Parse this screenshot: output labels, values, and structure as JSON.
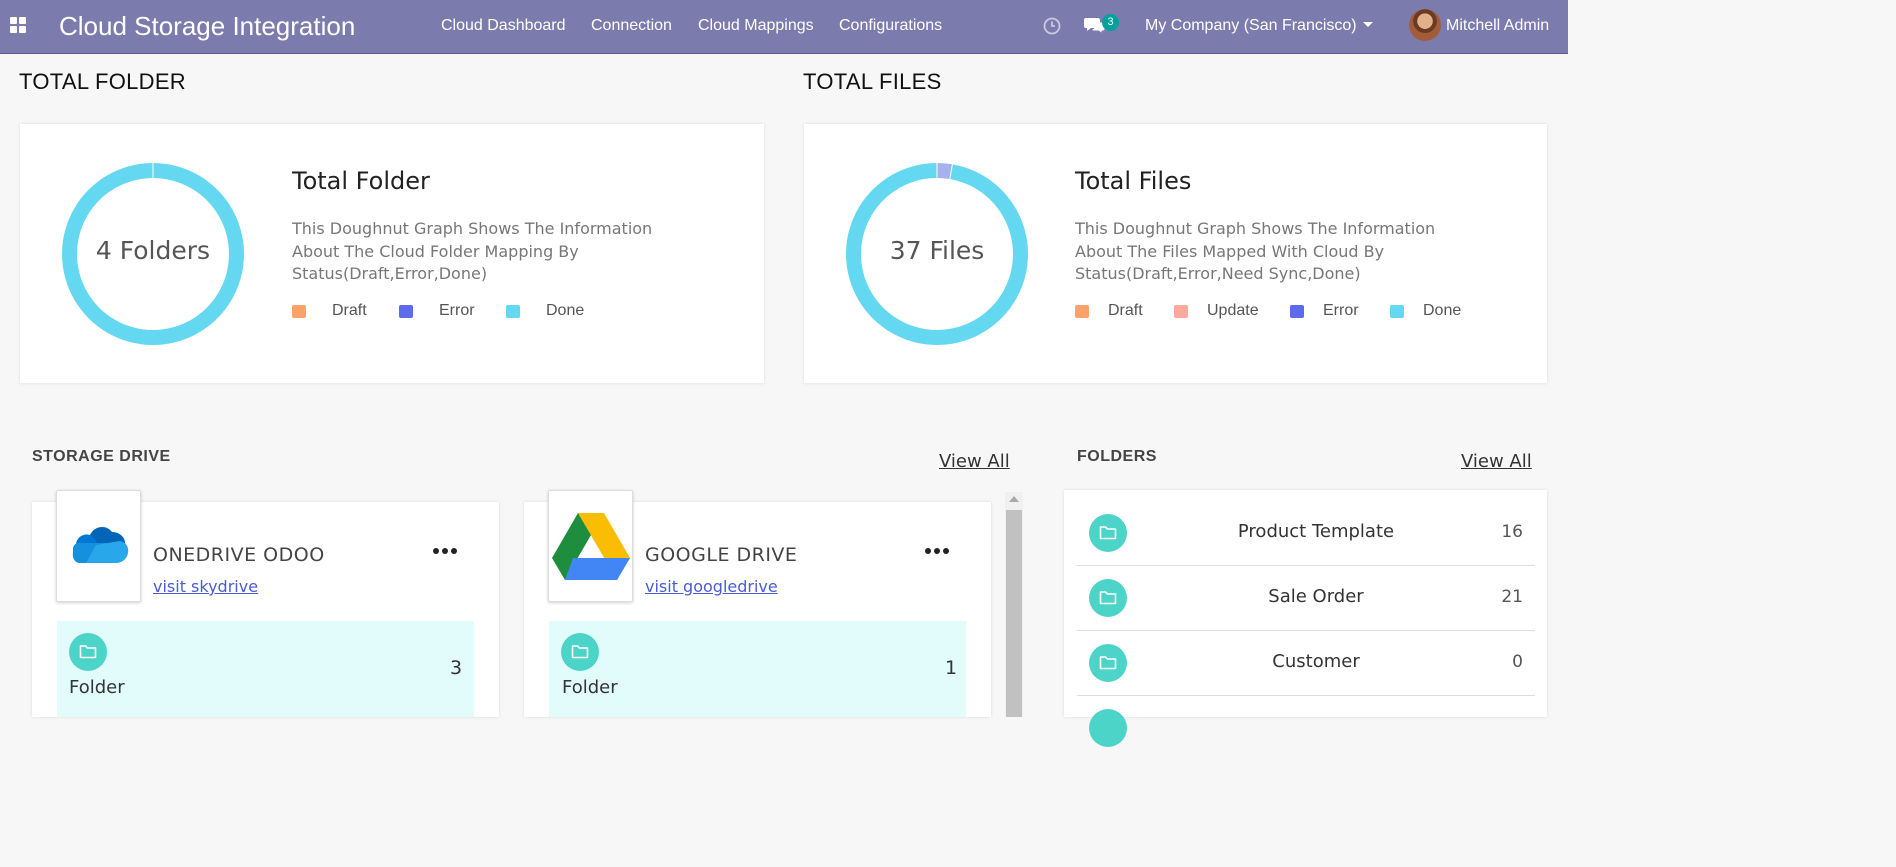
{
  "navbar": {
    "brand": "Cloud Storage Integration",
    "menu": [
      "Cloud Dashboard",
      "Connection",
      "Cloud Mappings",
      "Configurations"
    ],
    "messages_count": "3",
    "company": "My Company (San Francisco)",
    "user": "Mitchell Admin"
  },
  "total_folder": {
    "section_title": "TOTAL FOLDER",
    "center_label": "4 Folders",
    "heading": "Total Folder",
    "description": "This Doughnut Graph Shows The Information About The Cloud Folder Mapping By Status(Draft,Error,Done)",
    "legend": [
      {
        "label": "Draft",
        "color": "#fda26b"
      },
      {
        "label": "Error",
        "color": "#5b6bec"
      },
      {
        "label": "Done",
        "color": "#65d8f1"
      }
    ]
  },
  "total_files": {
    "section_title": "TOTAL FILES",
    "center_label": "37 Files",
    "heading": "Total Files",
    "description": "This Doughnut Graph Shows The Information About The Files Mapped With Cloud By Status(Draft,Error,Need Sync,Done)",
    "legend": [
      {
        "label": "Draft",
        "color": "#fda26b"
      },
      {
        "label": "Update",
        "color": "#fda99b"
      },
      {
        "label": "Error",
        "color": "#5b6bec"
      },
      {
        "label": "Done",
        "color": "#65d8f1"
      }
    ]
  },
  "chart_data": [
    {
      "type": "pie",
      "variant": "doughnut",
      "categories": [
        "Draft",
        "Error",
        "Done"
      ],
      "values": [
        0,
        0,
        4
      ],
      "colors": [
        "#fda26b",
        "#5b6bec",
        "#65d8f1"
      ]
    },
    {
      "type": "pie",
      "variant": "doughnut",
      "categories": [
        "Draft",
        "Update",
        "Error",
        "Done"
      ],
      "values": [
        0,
        1,
        0,
        36
      ],
      "colors": [
        "#fda26b",
        "#a8b1f0",
        "#5b6bec",
        "#65d8f1"
      ]
    }
  ],
  "storage_drive": {
    "title": "STORAGE DRIVE",
    "view_all": "View All",
    "drives": [
      {
        "name": "ONEDRIVE ODOO",
        "link": "visit skydrive",
        "folder_label": "Folder",
        "folder_count": "3",
        "icon": "onedrive-icon"
      },
      {
        "name": "GOOGLE DRIVE",
        "link": "visit googledrive",
        "folder_label": "Folder",
        "folder_count": "1",
        "icon": "google-drive-icon"
      }
    ]
  },
  "folders": {
    "title": "FOLDERS",
    "view_all": "View All",
    "items": [
      {
        "name": "Product Template",
        "count": "16"
      },
      {
        "name": "Sale Order",
        "count": "21"
      },
      {
        "name": "Customer",
        "count": "0"
      }
    ]
  }
}
